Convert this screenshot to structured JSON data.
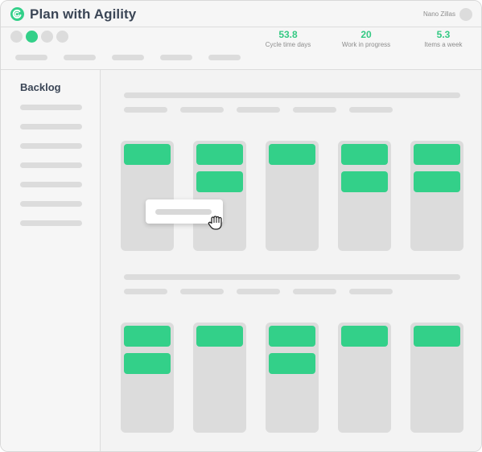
{
  "app": {
    "title": "Plan with Agility"
  },
  "user": {
    "name": "Nano Zillas"
  },
  "metrics": [
    {
      "value": "53.8",
      "label": "Cycle time days"
    },
    {
      "value": "20",
      "label": "Work in progress"
    },
    {
      "value": "5.3",
      "label": "Items a week"
    }
  ],
  "sidebar": {
    "title": "Backlog"
  },
  "colors": {
    "accent": "#33d089",
    "placeholder": "#dcdcdc",
    "title": "#3b4656"
  },
  "icons": {
    "logo": "agility-logo-icon",
    "cursor": "grab-hand-icon"
  },
  "board": {
    "swimlanes": [
      {
        "columns": [
          {
            "cards": 1
          },
          {
            "cards": 2
          },
          {
            "cards": 1
          },
          {
            "cards": 2
          },
          {
            "cards": 2
          }
        ]
      },
      {
        "columns": [
          {
            "cards": 2
          },
          {
            "cards": 1
          },
          {
            "cards": 2
          },
          {
            "cards": 1
          },
          {
            "cards": 1
          }
        ]
      }
    ]
  }
}
